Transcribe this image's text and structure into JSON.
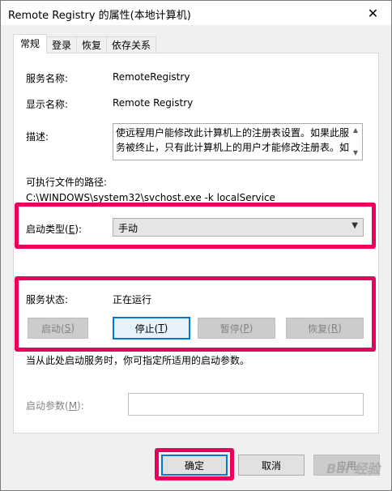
{
  "window": {
    "title": "Remote Registry 的属性(本地计算机)",
    "close_glyph": "✕"
  },
  "tabs": [
    {
      "label": "常规",
      "active": true
    },
    {
      "label": "登录",
      "active": false
    },
    {
      "label": "恢复",
      "active": false
    },
    {
      "label": "依存关系",
      "active": false
    }
  ],
  "general": {
    "service_name_label": "服务名称:",
    "service_name_value": "RemoteRegistry",
    "display_name_label": "显示名称:",
    "display_name_value": "Remote Registry",
    "description_label": "描述:",
    "description_value": "使远程用户能修改此计算机上的注册表设置。如果此服务被终止，只有此计算机上的用户才能修改注册表。如",
    "exe_path_label": "可执行文件的路径:",
    "exe_path_value": "C:\\WINDOWS\\system32\\svchost.exe -k localService",
    "startup_type_label": "启动类型(",
    "startup_type_key": "E",
    "startup_type_suffix": "):",
    "startup_type_value": "手动",
    "status_label": "服务状态:",
    "status_value": "正在运行",
    "start_label": "启动(",
    "start_key": "S",
    "stop_label": "停止(",
    "stop_key": "T",
    "pause_label": "暂停(",
    "pause_key": "P",
    "resume_label": "恢复(",
    "resume_key": "R",
    "paren_close": ")",
    "hint_text": "当从此处启动服务时，你可指定所适用的启动参数。",
    "params_label": "启动参数(",
    "params_key": "M",
    "params_suffix": "):",
    "params_value": ""
  },
  "footer": {
    "ok_label": "确定",
    "cancel_label": "取消",
    "apply_label": "应用"
  },
  "watermark": "Bai 经验",
  "colors": {
    "highlight": "#e8005a",
    "focus": "#0078d7"
  }
}
